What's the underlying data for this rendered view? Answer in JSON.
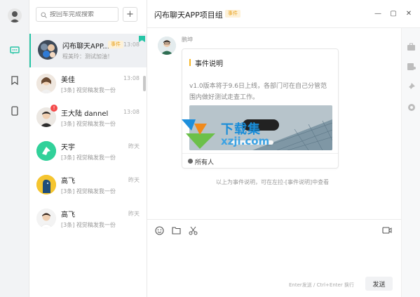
{
  "search": {
    "placeholder": "按回车完成搜索"
  },
  "add_label": "+",
  "header": {
    "title": "闪布聊天APP项目组",
    "tag": "事件"
  },
  "window": {
    "minimize": "—",
    "maximize": "▢",
    "close": "✕"
  },
  "chats": [
    {
      "name": "闪布聊天APP...",
      "tag": "事件",
      "time": "13:08",
      "preview": "程美玲：测试加油！",
      "active": true,
      "pinned": true
    },
    {
      "name": "美佳",
      "time": "13:08",
      "preview": "[3条] 视觉稿发我一份"
    },
    {
      "name": "王大陆 dannel",
      "time": "13:08",
      "preview": "[3条] 视觉稿发我一份",
      "badge": "!"
    },
    {
      "name": "天宇",
      "time": "昨天",
      "preview": "[3条] 视觉稿发我一份"
    },
    {
      "name": "高飞",
      "time": "昨天",
      "preview": "[3条] 视觉稿发我一份"
    },
    {
      "name": "高飞",
      "time": "昨天",
      "preview": "[3条] 视觉稿发我一份"
    }
  ],
  "message": {
    "sender": "鹏坤",
    "card_title": "事件说明",
    "card_body": "v1.0版本将于9.6日上线，各部门可在自己分管范围内做好测试走查工作。",
    "card_footer": "所有人",
    "system_note": "以上为事件说明，可在左拉-[事件说明]中查看"
  },
  "composer": {
    "hint": "Enter发送 / Ctrl+Enter 换行",
    "send_label": "发送"
  },
  "watermark": {
    "text": "下载集",
    "url": "xzji.com"
  },
  "colors": {
    "accent": "#27c5a6",
    "tag": "#e8a21e",
    "badge": "#f44b4b"
  }
}
